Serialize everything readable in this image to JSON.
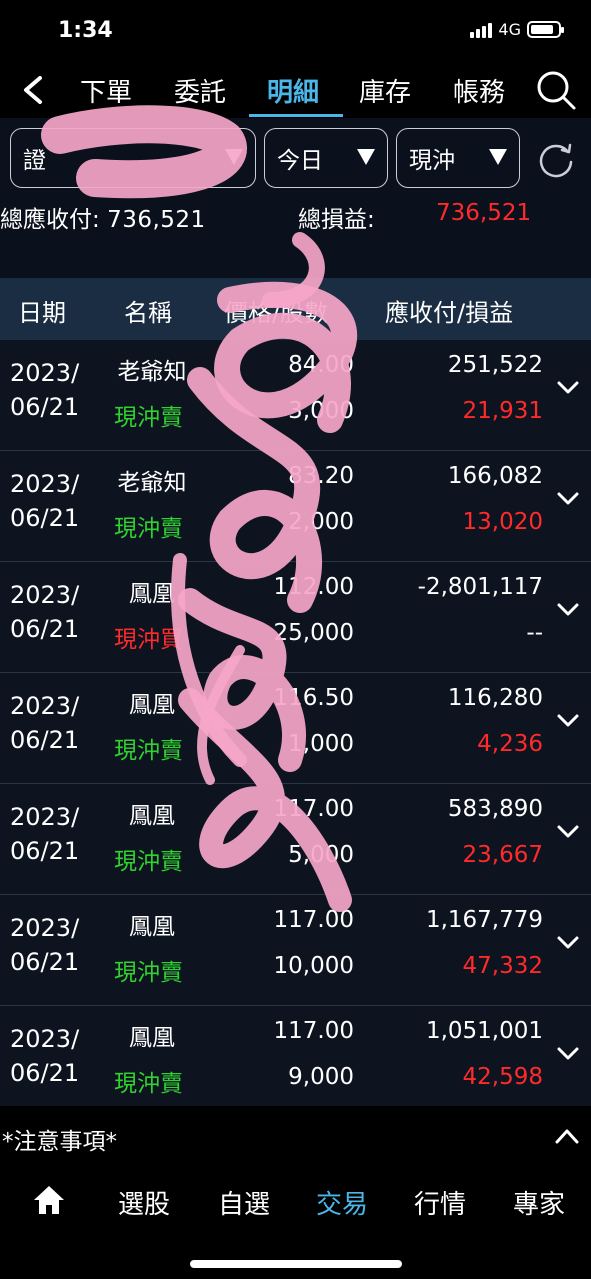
{
  "status": {
    "time": "1:34",
    "network": "4G"
  },
  "nav": {
    "tabs": [
      "下單",
      "委託",
      "明細",
      "庫存",
      "帳務"
    ],
    "active_tab": "明細"
  },
  "filters": {
    "account_label": "證",
    "period": "今日",
    "type": "現沖"
  },
  "summary": {
    "receivable_label": "總應收付:",
    "receivable_value": "736,521",
    "pl_label": "總損益:",
    "pl_value": "736,521"
  },
  "columns": {
    "date": "日期",
    "name": "名稱",
    "price_qty": "價格/股數",
    "amount_pl": "應收付/損益"
  },
  "rows": [
    {
      "date_y": "2023/",
      "date_md": "06/21",
      "name": "老爺知",
      "type": "現沖賣",
      "type_color": "green",
      "price": "84.00",
      "qty": "3,000",
      "amount": "251,522",
      "pl": "21,931"
    },
    {
      "date_y": "2023/",
      "date_md": "06/21",
      "name": "老爺知",
      "type": "現沖賣",
      "type_color": "green",
      "price": "83.20",
      "qty": "2,000",
      "amount": "166,082",
      "pl": "13,020"
    },
    {
      "date_y": "2023/",
      "date_md": "06/21",
      "name": "鳳凰",
      "type": "現沖買",
      "type_color": "red",
      "price": "112.00",
      "qty": "25,000",
      "amount": "-2,801,117",
      "pl": "--"
    },
    {
      "date_y": "2023/",
      "date_md": "06/21",
      "name": "鳳凰",
      "type": "現沖賣",
      "type_color": "green",
      "price": "116.50",
      "qty": "1,000",
      "amount": "116,280",
      "pl": "4,236"
    },
    {
      "date_y": "2023/",
      "date_md": "06/21",
      "name": "鳳凰",
      "type": "現沖賣",
      "type_color": "green",
      "price": "117.00",
      "qty": "5,000",
      "amount": "583,890",
      "pl": "23,667"
    },
    {
      "date_y": "2023/",
      "date_md": "06/21",
      "name": "鳳凰",
      "type": "現沖賣",
      "type_color": "green",
      "price": "117.00",
      "qty": "10,000",
      "amount": "1,167,779",
      "pl": "47,332"
    },
    {
      "date_y": "2023/",
      "date_md": "06/21",
      "name": "鳳凰",
      "type": "現沖賣",
      "type_color": "green",
      "price": "117.00",
      "qty": "9,000",
      "amount": "1,051,001",
      "pl": "42,598"
    }
  ],
  "notice": "*注意事項*",
  "tabbar": {
    "tabs": [
      "選股",
      "自選",
      "交易",
      "行情",
      "專家"
    ],
    "active_tab": "交易"
  },
  "colors": {
    "accent": "#4ab7e8",
    "gain": "#ff2a2a",
    "sell": "#2fd22f",
    "buy": "#ff2a2a",
    "header_bg": "#1a2d43"
  }
}
